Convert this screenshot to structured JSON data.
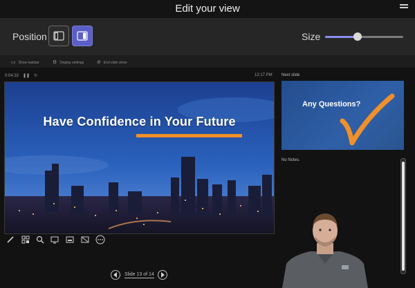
{
  "window": {
    "title": "Edit your view"
  },
  "position": {
    "label": "Position",
    "options": [
      "presenter-left",
      "presenter-right"
    ],
    "selected": "presenter-right"
  },
  "size": {
    "label": "Size",
    "value": 0.42
  },
  "presenter": {
    "ribbon": [
      "Show taskbar",
      "Display settings",
      "End slide show"
    ],
    "timer": "0:04:33",
    "clock": "12:17 PM",
    "next_label": "Next slide",
    "current_slide": {
      "headline": "Have Confidence in Your Future"
    },
    "next_slide": {
      "headline": "Any Questions?"
    },
    "notes": "No Notes.",
    "slide_counter": "Slide 13 of 14"
  },
  "colors": {
    "accent": "#5b5fc7",
    "slide_orange": "#f0902a",
    "background": "#1b1b1b"
  }
}
